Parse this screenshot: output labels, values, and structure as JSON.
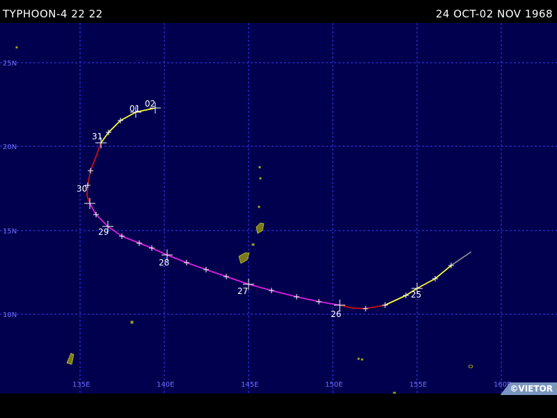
{
  "header": {
    "title_left": "TYPHOON-4 22 22",
    "title_right": "24 OCT-02 NOV 1968"
  },
  "credit": "©VIETOR",
  "colors": {
    "ocean": "#00004e",
    "grid": "#3a3aff",
    "land": "#7a7a1a",
    "track_depression": "#888888",
    "track_storm": "#ffff33",
    "track_typhoon": "#cc1111",
    "track_super": "#dd22dd",
    "marker": "#ffffff"
  },
  "map": {
    "lat_labels": [
      "10N",
      "15N",
      "20N",
      "25N"
    ],
    "lon_labels": [
      "135E",
      "140E",
      "145E",
      "150E",
      "155E",
      "160E"
    ],
    "date_labels": [
      "25",
      "26",
      "27",
      "28",
      "29",
      "30",
      "31",
      "01",
      "02"
    ]
  }
}
